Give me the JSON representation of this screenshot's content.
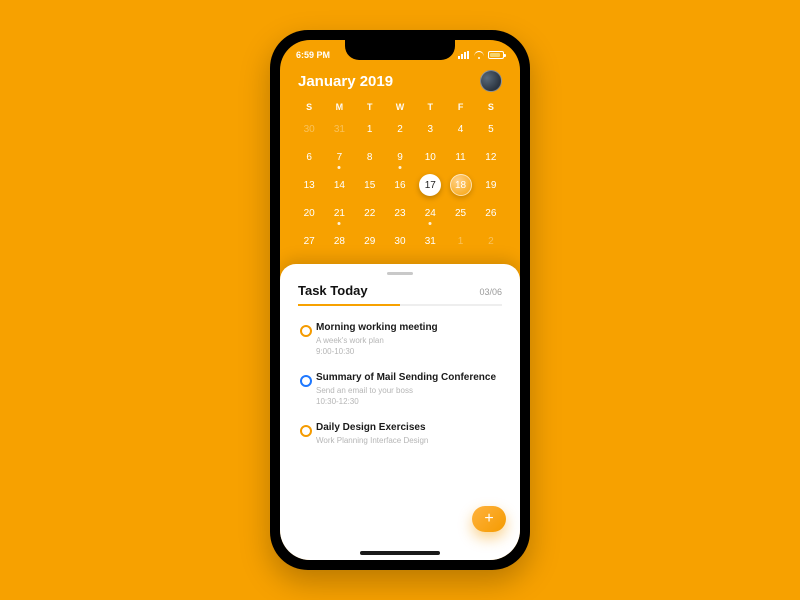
{
  "status": {
    "time": "6:59 PM"
  },
  "header": {
    "title": "January 2019"
  },
  "calendar": {
    "dow": [
      "S",
      "M",
      "T",
      "W",
      "T",
      "F",
      "S"
    ],
    "weeks": [
      [
        {
          "n": "30",
          "muted": true
        },
        {
          "n": "31",
          "muted": true
        },
        {
          "n": "1"
        },
        {
          "n": "2"
        },
        {
          "n": "3"
        },
        {
          "n": "4"
        },
        {
          "n": "5"
        }
      ],
      [
        {
          "n": "6"
        },
        {
          "n": "7",
          "dot": true
        },
        {
          "n": "8"
        },
        {
          "n": "9",
          "dot": true
        },
        {
          "n": "10"
        },
        {
          "n": "11"
        },
        {
          "n": "12"
        }
      ],
      [
        {
          "n": "13"
        },
        {
          "n": "14"
        },
        {
          "n": "15"
        },
        {
          "n": "16"
        },
        {
          "n": "17",
          "selected": true
        },
        {
          "n": "18",
          "today": true
        },
        {
          "n": "19"
        }
      ],
      [
        {
          "n": "20"
        },
        {
          "n": "21",
          "dot": true
        },
        {
          "n": "22"
        },
        {
          "n": "23"
        },
        {
          "n": "24",
          "dot": true
        },
        {
          "n": "25"
        },
        {
          "n": "26"
        }
      ],
      [
        {
          "n": "27"
        },
        {
          "n": "28"
        },
        {
          "n": "29"
        },
        {
          "n": "30"
        },
        {
          "n": "31"
        },
        {
          "n": "1",
          "muted": true
        },
        {
          "n": "2",
          "muted": true
        }
      ]
    ]
  },
  "sheet": {
    "title": "Task Today",
    "count": "03/06",
    "progress_pct": 50
  },
  "tasks": [
    {
      "title": "Morning working meeting",
      "subtitle": "A week's work plan",
      "time": "9:00-10:30",
      "ring": "#f59b00"
    },
    {
      "title": "Summary of Mail Sending Conference",
      "subtitle": "Send an email to your boss",
      "time": "10:30-12:30",
      "ring": "#1e78ff"
    },
    {
      "title": "Daily Design Exercises",
      "subtitle": "Work Planning Interface Design",
      "time": "",
      "ring": "#f59b00"
    }
  ],
  "fab": {
    "glyph": "+"
  }
}
